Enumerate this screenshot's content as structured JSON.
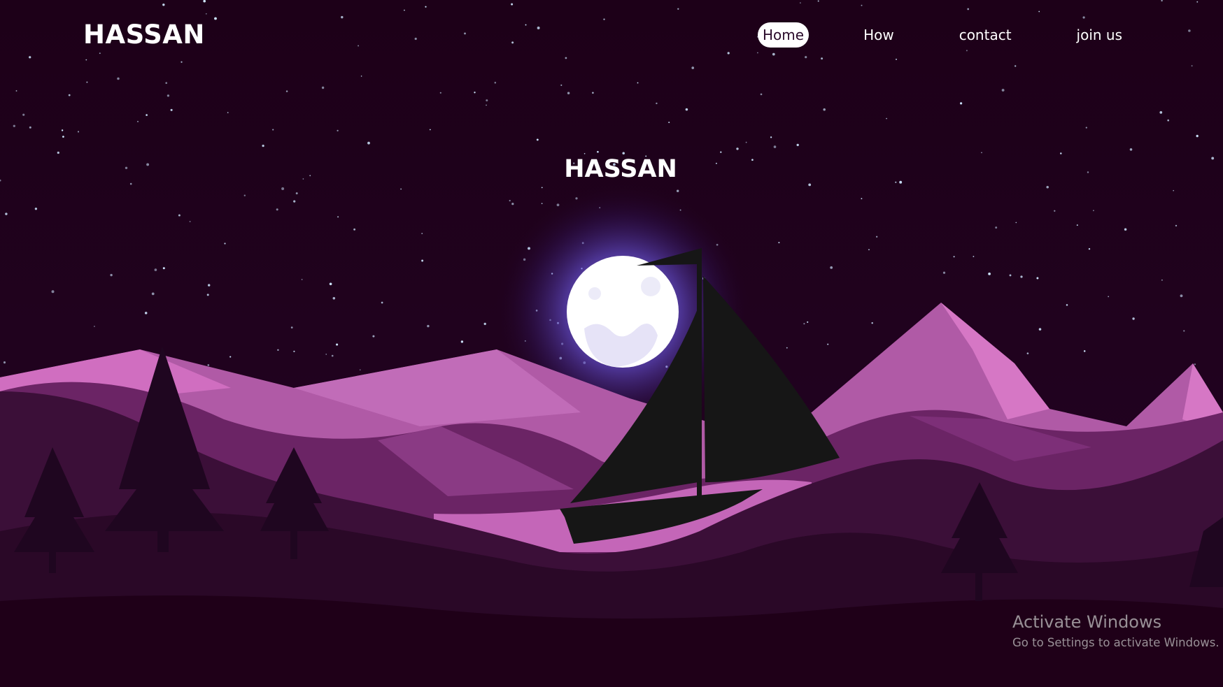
{
  "header": {
    "logo": "HASSAN",
    "nav": [
      {
        "label": "Home",
        "active": true
      },
      {
        "label": "How",
        "active": false
      },
      {
        "label": "contact",
        "active": false
      },
      {
        "label": "join us",
        "active": false
      }
    ]
  },
  "hero": {
    "title": "HASSAN"
  },
  "watermark": {
    "title": "Activate Windows",
    "subtitle": "Go to Settings to activate Windows."
  },
  "colors": {
    "background": "#1f0018",
    "mountain_light": "#c45fb0",
    "mountain_mid": "#a04a98",
    "hill_dark": "#3a0f35",
    "moon": "#ffffff",
    "moon_glow": "#7b6cff",
    "boat": "#161616"
  },
  "icons": {
    "moon": "moon-icon",
    "sailboat": "sailboat-icon"
  }
}
